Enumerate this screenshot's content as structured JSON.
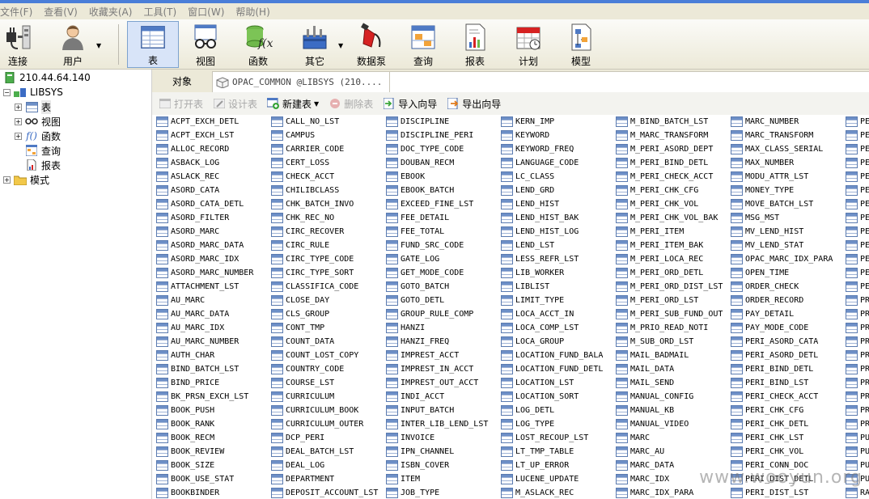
{
  "menubar": [
    "文件(F)",
    "查看(V)",
    "收藏夹(A)",
    "工具(T)",
    "窗口(W)",
    "帮助(H)"
  ],
  "toolbar": {
    "connect": "连接",
    "user": "用户",
    "table": "表",
    "view": "视图",
    "function": "函数",
    "other": "其它",
    "pump": "数据泵",
    "query": "查询",
    "report": "报表",
    "schedule": "计划",
    "model": "模型"
  },
  "tree": {
    "server": "210.44.64.140",
    "schema": "LIBSYS",
    "tables": "表",
    "views": "视图",
    "functions": "函数",
    "queries": "查询",
    "reports": "报表",
    "models": "模式"
  },
  "tabs": {
    "objects": "对象",
    "current": "OPAC_COMMON @LIBSYS (210...."
  },
  "object_toolbar": {
    "open": "打开表",
    "design": "设计表",
    "new": "新建表",
    "delete": "删除表",
    "import": "导入向导",
    "export": "导出向导"
  },
  "table_columns": [
    [
      "ACPT_EXCH_DETL",
      "ACPT_EXCH_LST",
      "ALLOC_RECORD",
      "ASBACK_LOG",
      "ASLACK_REC",
      "ASORD_CATA",
      "ASORD_CATA_DETL",
      "ASORD_FILTER",
      "ASORD_MARC",
      "ASORD_MARC_DATA",
      "ASORD_MARC_IDX",
      "ASORD_MARC_NUMBER",
      "ATTACHMENT_LST",
      "AU_MARC",
      "AU_MARC_DATA",
      "AU_MARC_IDX",
      "AU_MARC_NUMBER",
      "AUTH_CHAR",
      "BIND_BATCH_LST",
      "BIND_PRICE",
      "BK_PRSN_EXCH_LST",
      "BOOK_PUSH",
      "BOOK_RANK",
      "BOOK_RECM",
      "BOOK_REVIEW",
      "BOOK_SIZE",
      "BOOK_USE_STAT",
      "BOOKBINDER"
    ],
    [
      "CALL_NO_LST",
      "CAMPUS",
      "CARRIER_CODE",
      "CERT_LOSS",
      "CHECK_ACCT",
      "CHILIBCLASS",
      "CHK_BATCH_INVO",
      "CHK_REC_NO",
      "CIRC_RECOVER",
      "CIRC_RULE",
      "CIRC_TYPE_CODE",
      "CIRC_TYPE_SORT",
      "CLASSIFICA_CODE",
      "CLOSE_DAY",
      "CLS_GROUP",
      "CONT_TMP",
      "COUNT_DATA",
      "COUNT_LOST_COPY",
      "COUNTRY_CODE",
      "COURSE_LST",
      "CURRICULUM",
      "CURRICULUM_BOOK",
      "CURRICULUM_OUTER",
      "DCP_PERI",
      "DEAL_BATCH_LST",
      "DEAL_LOG",
      "DEPARTMENT",
      "DEPOSIT_ACCOUNT_LST"
    ],
    [
      "DISCIPLINE",
      "DISCIPLINE_PERI",
      "DOC_TYPE_CODE",
      "DOUBAN_RECM",
      "EBOOK",
      "EBOOK_BATCH",
      "EXCEED_FINE_LST",
      "FEE_DETAIL",
      "FEE_TOTAL",
      "FUND_SRC_CODE",
      "GATE_LOG",
      "GET_MODE_CODE",
      "GOTO_BATCH",
      "GOTO_DETL",
      "GROUP_RULE_COMP",
      "HANZI",
      "HANZI_FREQ",
      "IMPREST_ACCT",
      "IMPREST_IN_ACCT",
      "IMPREST_OUT_ACCT",
      "INDI_ACCT",
      "INPUT_BATCH",
      "INTER_LIB_LEND_LST",
      "INVOICE",
      "IPN_CHANNEL",
      "ISBN_COVER",
      "ITEM",
      "JOB_TYPE"
    ],
    [
      "KERN_IMP",
      "KEYWORD",
      "KEYWORD_FREQ",
      "LANGUAGE_CODE",
      "LC_CLASS",
      "LEND_GRD",
      "LEND_HIST",
      "LEND_HIST_BAK",
      "LEND_HIST_LOG",
      "LEND_LST",
      "LESS_REFR_LST",
      "LIB_WORKER",
      "LIBLIST",
      "LIMIT_TYPE",
      "LOCA_ACCT_IN",
      "LOCA_COMP_LST",
      "LOCA_GROUP",
      "LOCATION_FUND_BALA",
      "LOCATION_FUND_DETL",
      "LOCATION_LST",
      "LOCATION_SORT",
      "LOG_DETL",
      "LOG_TYPE",
      "LOST_RECOUP_LST",
      "LT_TMP_TABLE",
      "LT_UP_ERROR",
      "LUCENE_UPDATE",
      "M_ASLACK_REC"
    ],
    [
      "M_BIND_BATCH_LST",
      "M_MARC_TRANSFORM",
      "M_PERI_ASORD_DEPT",
      "M_PERI_BIND_DETL",
      "M_PERI_CHECK_ACCT",
      "M_PERI_CHK_CFG",
      "M_PERI_CHK_VOL",
      "M_PERI_CHK_VOL_BAK",
      "M_PERI_ITEM",
      "M_PERI_ITEM_BAK",
      "M_PERI_LOCA_REC",
      "M_PERI_ORD_DETL",
      "M_PERI_ORD_DIST_LST",
      "M_PERI_ORD_LST",
      "M_PERI_SUB_FUND_OUT",
      "M_PRIO_READ_NOTI",
      "M_SUB_ORD_LST",
      "MAIL_BADMAIL",
      "MAIL_DATA",
      "MAIL_SEND",
      "MANUAL_CONFIG",
      "MANUAL_KB",
      "MANUAL_VIDEO",
      "MARC",
      "MARC_AU",
      "MARC_DATA",
      "MARC_IDX",
      "MARC_IDX_PARA"
    ],
    [
      "MARC_NUMBER",
      "MARC_TRANSFORM",
      "MAX_CLASS_SERIAL",
      "MAX_NUMBER",
      "MODU_ATTR_LST",
      "MONEY_TYPE",
      "MOVE_BATCH_LST",
      "MSG_MST",
      "MV_LEND_HIST",
      "MV_LEND_STAT",
      "OPAC_MARC_IDX_PARA",
      "OPEN_TIME",
      "ORDER_CHECK",
      "ORDER_RECORD",
      "PAY_DETAIL",
      "PAY_MODE_CODE",
      "PERI_ASORD_CATA",
      "PERI_ASORD_DETL",
      "PERI_BIND_DETL",
      "PERI_BIND_LST",
      "PERI_CHECK_ACCT",
      "PERI_CHK_CFG",
      "PERI_CHK_DETL",
      "PERI_CHK_LST",
      "PERI_CHK_VOL",
      "PERI_CONN_DOC",
      "PERI_DIST_DETL",
      "PERI_DIST_LST"
    ],
    [
      "PE",
      "PE",
      "PE",
      "PE",
      "PE",
      "PE",
      "PE",
      "PE",
      "PE",
      "PE",
      "PE",
      "PE",
      "PE",
      "PR",
      "PR",
      "PR",
      "PR",
      "PR",
      "PR",
      "PR",
      "PR",
      "PR",
      "PR",
      "PU",
      "PU",
      "PU",
      "PU",
      "RA"
    ]
  ],
  "watermark": "www.wooyun.org"
}
